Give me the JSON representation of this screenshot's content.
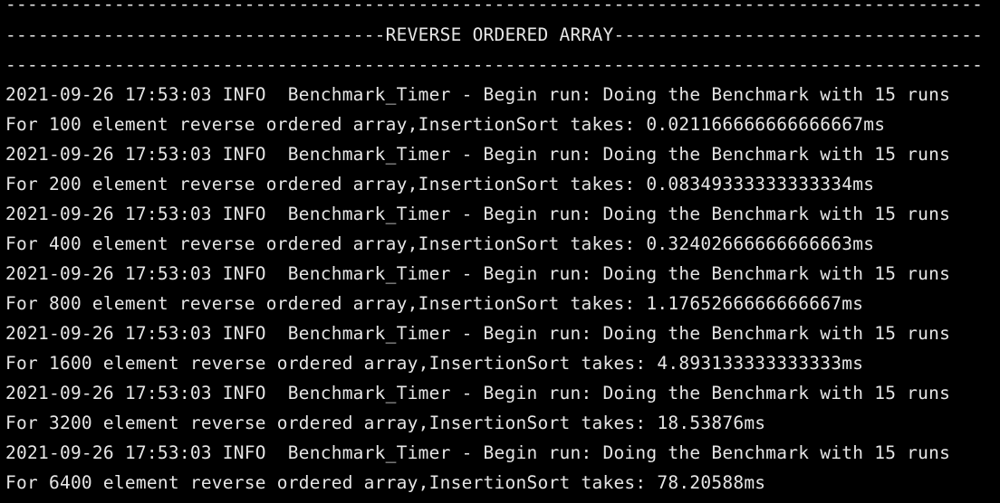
{
  "terminal": {
    "colors": {
      "background": "#000000",
      "text": "#e6e6e6"
    },
    "lines": [
      "------------------------------------------------------------------------------------------",
      "-----------------------------------REVERSE ORDERED ARRAY----------------------------------",
      "------------------------------------------------------------------------------------------",
      "2021-09-26 17:53:03 INFO  Benchmark_Timer - Begin run: Doing the Benchmark with 15 runs",
      "For 100 element reverse ordered array,InsertionSort takes: 0.021166666666666667ms",
      "2021-09-26 17:53:03 INFO  Benchmark_Timer - Begin run: Doing the Benchmark with 15 runs",
      "For 200 element reverse ordered array,InsertionSort takes: 0.08349333333333334ms",
      "2021-09-26 17:53:03 INFO  Benchmark_Timer - Begin run: Doing the Benchmark with 15 runs",
      "For 400 element reverse ordered array,InsertionSort takes: 0.32402666666666663ms",
      "2021-09-26 17:53:03 INFO  Benchmark_Timer - Begin run: Doing the Benchmark with 15 runs",
      "For 800 element reverse ordered array,InsertionSort takes: 1.1765266666666667ms",
      "2021-09-26 17:53:03 INFO  Benchmark_Timer - Begin run: Doing the Benchmark with 15 runs",
      "For 1600 element reverse ordered array,InsertionSort takes: 4.893133333333333ms",
      "2021-09-26 17:53:03 INFO  Benchmark_Timer - Begin run: Doing the Benchmark with 15 runs",
      "For 3200 element reverse ordered array,InsertionSort takes: 18.53876ms",
      "2021-09-26 17:53:03 INFO  Benchmark_Timer - Begin run: Doing the Benchmark with 15 runs",
      "For 6400 element reverse ordered array,InsertionSort takes: 78.20588ms"
    ]
  }
}
